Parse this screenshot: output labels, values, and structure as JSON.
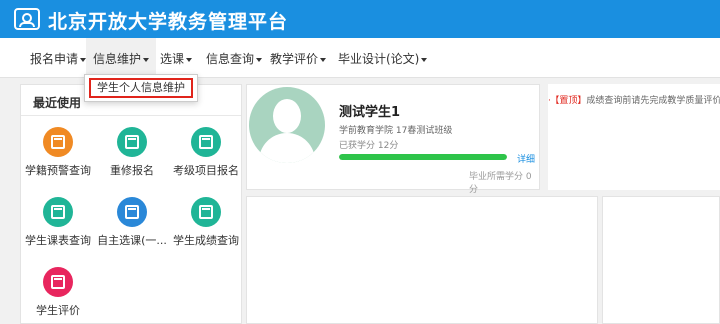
{
  "app": {
    "title": "北京开放大学教务管理平台"
  },
  "nav": {
    "items": [
      {
        "label": "报名申请"
      },
      {
        "label": "信息维护"
      },
      {
        "label": "选课"
      },
      {
        "label": "信息查询"
      },
      {
        "label": "教学评价"
      },
      {
        "label": "毕业设计(论文)"
      }
    ],
    "active_index": 1,
    "dropdown": {
      "items": [
        {
          "label": "学生个人信息维护"
        }
      ]
    }
  },
  "recent": {
    "title": "最近使用",
    "tiles": [
      {
        "label": "学籍预警查询",
        "icon": "warning-pencil-icon",
        "color": "#f08a24"
      },
      {
        "label": "重修报名",
        "icon": "book-icon",
        "color": "#20b597"
      },
      {
        "label": "考级项目报名",
        "icon": "exam-person-icon",
        "color": "#20b597"
      },
      {
        "label": "学生课表查询",
        "icon": "timetable-icon",
        "color": "#20b597"
      },
      {
        "label": "自主选课(一...",
        "icon": "window-icon",
        "color": "#2a88d8"
      },
      {
        "label": "学生成绩查询",
        "icon": "grid-icon",
        "color": "#20b597"
      },
      {
        "label": "学生评价",
        "icon": "evaluation-icon",
        "color": "#e8265e"
      }
    ]
  },
  "profile": {
    "name": "测试学生1",
    "school": "学前教育学院 17春测试班级",
    "credits": "已获学分 12分",
    "progress_fraction": 1.0,
    "detail_link": "详细",
    "required": "毕业所需学分 0分"
  },
  "notice": {
    "tag": "【置顶】",
    "text": "成绩查询前请先完成教学质量评价"
  },
  "colors": {
    "brand": "#1a8fe0",
    "progress": "#2ec44a",
    "notice_tag": "#e0241b"
  }
}
